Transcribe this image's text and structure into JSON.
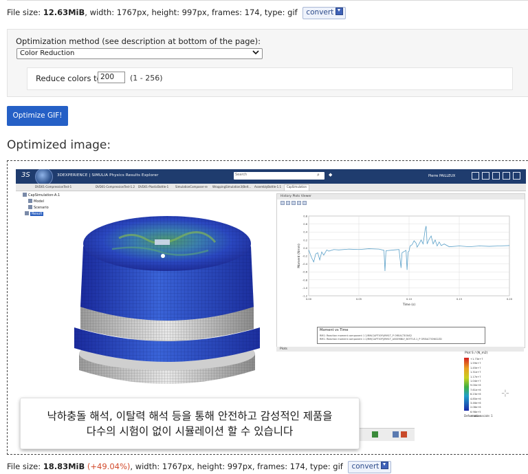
{
  "original_info": {
    "prefix": "File size: ",
    "size": "12.63MiB",
    "rest": ", width: 1767px, height: 997px, frames: 174, type: gif",
    "convert_label": "convert"
  },
  "optimization": {
    "method_label": "Optimization method (see description at bottom of the page):",
    "method_selected": "Color Reduction",
    "reduce_label": "Reduce colors to",
    "reduce_value": "200",
    "reduce_range": "(1 - 256)"
  },
  "optimize_button": "Optimize GIF!",
  "result_heading": "Optimized image:",
  "optimized_info": {
    "prefix": "File size: ",
    "size": "18.83MiB",
    "change": "(+49.04%)",
    "rest": ", width: 1767px, height: 997px, frames: 174, type: gif",
    "convert_label": "convert"
  },
  "screenshot": {
    "logo": "3S",
    "brand": "3DEXPERIENCE | SIMULIA Physics Results Explorer",
    "search_placeholder": "Search",
    "user": "Pierre PAILLEUX",
    "tabs": [
      "DVD01-CompressionTest-1",
      "DVD01-CompressionTest-1.2",
      "DVD01-PlasticBottle-1",
      "SimulationComposer-re",
      "WrappingSimulation3(Belt...",
      "AssemblyBottle-1.1",
      "CapSimulation"
    ],
    "tree": {
      "root": "CapSimulation-A.1",
      "items": [
        "Model",
        "Scenario",
        "Result"
      ]
    },
    "history_panel": "History Plots Viewer",
    "plots_panel": "Plots",
    "legend_title": "Moment vs Time",
    "legend_lines": [
      "RM1: Reaction moment component 1 2/RM(CAPTIOP)/RM1T_P      OREACTIONS2",
      "RM1: Reaction moment component 1 2/RM(CAPTIOP)/RM1T_ASSEMBLY_BOTTLE-1_P      OREACTIONS2ZD"
    ],
    "colorbar_title": "Plot S / (N_m2)",
    "colorbar_labels": [
      "+1.73e+7",
      "1.59e+7",
      "1.45e+7",
      "1.31e+7",
      "1.17e+7",
      "1.04e+7",
      "9.00e+6",
      "7.61e+6",
      "6.23e+6",
      "4.85e+6",
      "3.46e+6",
      "2.08e+6",
      "6.98e+5",
      "-6.86e+4"
    ],
    "deformation_label": "Deformation scale: 1",
    "subtitle_line1": "낙하충돌 해석, 이탈력 해석 등을 통해 안전하고 감성적인 제품을",
    "subtitle_line2": "다수의 시험이 없이 시뮬레이션 할 수 있습니다"
  },
  "chart_data": {
    "type": "line",
    "title": "",
    "xlabel": "Time (s)",
    "ylabel": "Moment (Nmm)",
    "x_ticks": [
      "0.00",
      "0.05",
      "0.10",
      "0.15",
      "0.20"
    ],
    "y_ticks": [
      "0.8",
      "0.6",
      "0.4",
      "0.2",
      "0.0",
      "-0.2",
      "-0.4",
      "-0.6",
      "-0.8",
      "-1.0",
      "-1.2"
    ],
    "xlim": [
      0,
      0.2
    ],
    "ylim": [
      -1.2,
      0.8
    ],
    "grid": true,
    "series": [
      {
        "name": "RM1T_P",
        "color": "#5aa0c8",
        "points": [
          [
            0.0,
            -0.05
          ],
          [
            0.003,
            -0.25
          ],
          [
            0.005,
            -0.35
          ],
          [
            0.007,
            -0.15
          ],
          [
            0.009,
            -0.12
          ],
          [
            0.011,
            -0.3
          ],
          [
            0.013,
            -0.1
          ],
          [
            0.015,
            -0.18
          ],
          [
            0.018,
            -0.05
          ],
          [
            0.02,
            -0.08
          ],
          [
            0.025,
            -0.04
          ],
          [
            0.03,
            -0.05
          ],
          [
            0.04,
            -0.03
          ],
          [
            0.05,
            -0.04
          ],
          [
            0.06,
            -0.02
          ],
          [
            0.07,
            -0.03
          ],
          [
            0.075,
            -0.06
          ],
          [
            0.076,
            -0.58
          ],
          [
            0.077,
            -0.07
          ],
          [
            0.085,
            -0.05
          ],
          [
            0.09,
            -0.04
          ],
          [
            0.092,
            -0.5
          ],
          [
            0.093,
            -0.12
          ],
          [
            0.097,
            -0.06
          ],
          [
            0.098,
            -0.55
          ],
          [
            0.099,
            -0.1
          ],
          [
            0.1,
            -0.08
          ],
          [
            0.101,
            0.05
          ],
          [
            0.103,
            0.08
          ],
          [
            0.105,
            0.18
          ],
          [
            0.107,
            0.12
          ],
          [
            0.108,
            0.02
          ],
          [
            0.11,
            0.1
          ],
          [
            0.112,
            0.2
          ],
          [
            0.114,
            0.1
          ],
          [
            0.116,
            0.45
          ],
          [
            0.117,
            0.55
          ],
          [
            0.118,
            0.1
          ],
          [
            0.12,
            0.22
          ],
          [
            0.122,
            0.3
          ],
          [
            0.124,
            0.1
          ],
          [
            0.126,
            0.2
          ],
          [
            0.128,
            0.05
          ],
          [
            0.13,
            0.15
          ],
          [
            0.132,
            0.06
          ],
          [
            0.135,
            0.1
          ],
          [
            0.14,
            0.03
          ],
          [
            0.15,
            0.05
          ],
          [
            0.16,
            0.03
          ],
          [
            0.17,
            0.05
          ],
          [
            0.18,
            0.04
          ],
          [
            0.19,
            0.05
          ],
          [
            0.2,
            0.06
          ]
        ]
      }
    ]
  }
}
